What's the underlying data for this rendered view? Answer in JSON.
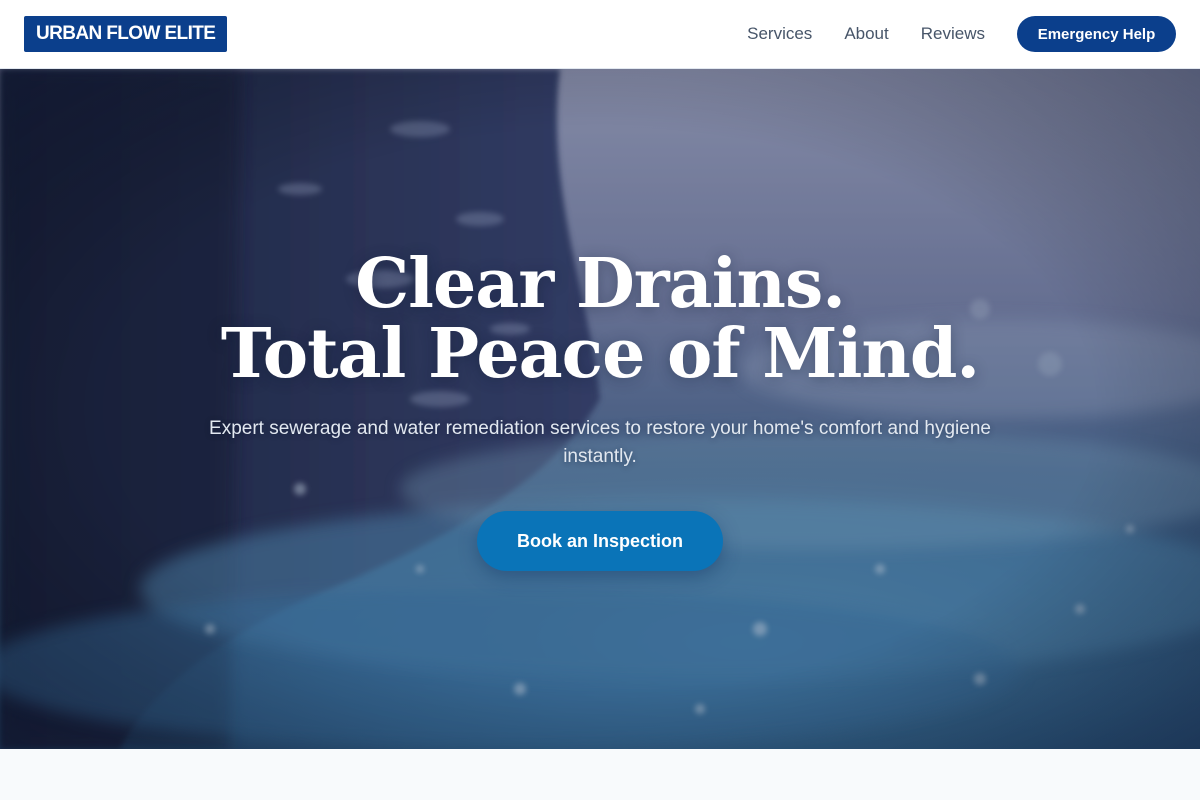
{
  "header": {
    "logo_text": "URBAN FLOW ELITE",
    "nav": [
      {
        "label": "Services"
      },
      {
        "label": "About"
      },
      {
        "label": "Reviews"
      }
    ],
    "emergency_label": "Emergency Help"
  },
  "hero": {
    "title_line1": "Clear Drains.",
    "title_line2": "Total Peace of Mind.",
    "subtitle": "Expert sewerage and water remediation services to restore your home's comfort and hygiene instantly.",
    "cta_label": "Book an Inspection"
  },
  "colors": {
    "brand": "#0b3f8c",
    "cta": "#0a74b8",
    "page_background": "#f8fafc"
  }
}
